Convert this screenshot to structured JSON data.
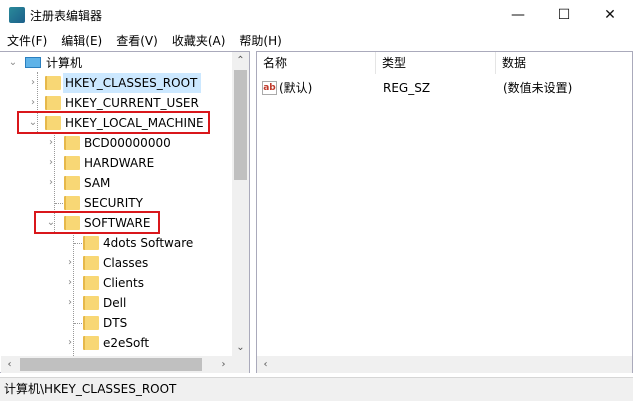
{
  "window": {
    "title": "注册表编辑器",
    "minimize": "—",
    "maximize": "☐",
    "close": "✕"
  },
  "menu": [
    "文件(F)",
    "编辑(E)",
    "查看(V)",
    "收藏夹(A)",
    "帮助(H)"
  ],
  "tree": {
    "root": "计算机",
    "hives": [
      "HKEY_CLASSES_ROOT",
      "HKEY_CURRENT_USER",
      "HKEY_LOCAL_MACHINE"
    ],
    "hklm_children": [
      "BCD00000000",
      "HARDWARE",
      "SAM",
      "SECURITY",
      "SOFTWARE"
    ],
    "software_children": [
      "4dots Software",
      "Classes",
      "Clients",
      "Dell",
      "DTS",
      "e2eSoft"
    ]
  },
  "list": {
    "columns": [
      "名称",
      "类型",
      "数据"
    ],
    "rows": [
      {
        "name": "(默认)",
        "type": "REG_SZ",
        "data": "(数值未设置)"
      }
    ]
  },
  "status": "计算机\\HKEY_CLASSES_ROOT"
}
